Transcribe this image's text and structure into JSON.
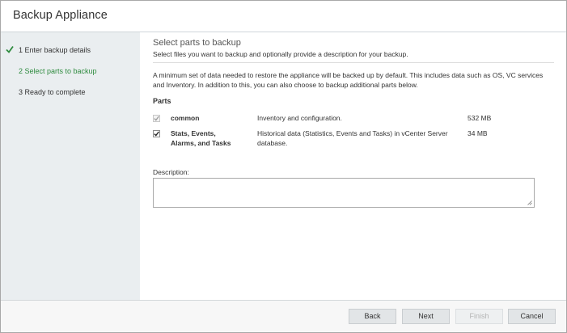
{
  "window": {
    "title": "Backup Appliance"
  },
  "sidebar": {
    "steps": [
      {
        "label": "1 Enter backup details",
        "state": "completed"
      },
      {
        "label": "2 Select parts to backup",
        "state": "active"
      },
      {
        "label": "3 Ready to complete",
        "state": "pending"
      }
    ]
  },
  "main": {
    "title": "Select parts to backup",
    "subtitle": "Select files you want to backup and optionally provide a description for your backup.",
    "info": "A minimum set of data needed to restore the appliance will be backed up by default. This includes data such as OS, VC services and Inventory. In addition to this, you can also choose to backup additional parts below.",
    "parts_label": "Parts",
    "parts": [
      {
        "name": "common",
        "description": "Inventory and configuration.",
        "size": "532 MB",
        "checked": true,
        "disabled": true
      },
      {
        "name": "Stats, Events, Alarms, and Tasks",
        "description": "Historical data (Statistics, Events and Tasks) in vCenter Server database.",
        "size": "34 MB",
        "checked": true,
        "disabled": false
      }
    ],
    "description_label": "Description:",
    "description_value": ""
  },
  "footer": {
    "back": "Back",
    "next": "Next",
    "finish": "Finish",
    "cancel": "Cancel"
  },
  "colors": {
    "active_step": "#2e8b3e",
    "sidebar_bg": "#eaeef0",
    "button_bg": "#e2e5e7"
  },
  "icons": {
    "completed_step": "check-icon",
    "resize": "resize-grip-icon"
  }
}
